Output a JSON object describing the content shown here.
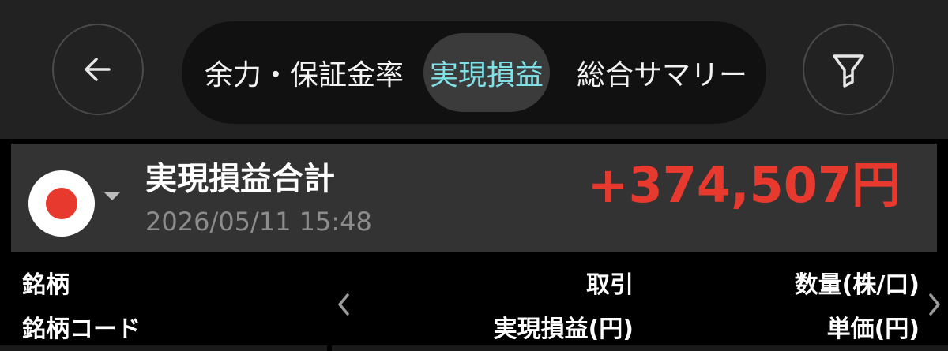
{
  "header": {
    "back_icon": "arrow-left-icon",
    "filter_icon": "funnel-icon",
    "tabs": [
      {
        "label": "余力・保証金率",
        "active": false
      },
      {
        "label": "実現損益",
        "active": true
      },
      {
        "label": "総合サマリー",
        "active": false
      }
    ]
  },
  "summary": {
    "region_icon": "japan-flag-icon",
    "title": "実現損益合計",
    "timestamp": "2026/05/11 15:48",
    "amount": "+374,507円"
  },
  "columns": {
    "left_top": "銘柄",
    "left_bottom": "銘柄コード",
    "middle_top": "取引",
    "middle_bottom": "実現損益(円)",
    "right_top": "数量(株/口)",
    "right_bottom": "単価(円)"
  },
  "colors": {
    "accent_tab": "#7fe0e6",
    "profit": "#e8392e",
    "header_bg": "#222222",
    "card_bg": "#333333"
  }
}
